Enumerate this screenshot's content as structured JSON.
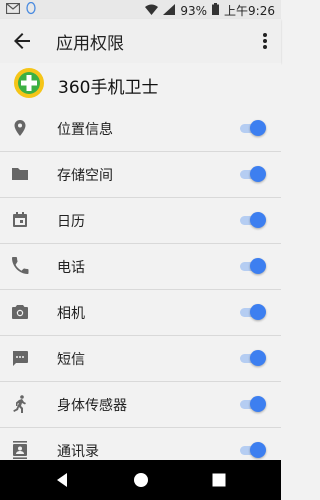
{
  "status": {
    "battery": "93%",
    "time": "上午9:26"
  },
  "appbar": {
    "title": "应用权限"
  },
  "app": {
    "name": "360手机卫士"
  },
  "permissions": [
    {
      "label": "位置信息",
      "icon": "location-icon",
      "enabled": true
    },
    {
      "label": "存储空间",
      "icon": "folder-icon",
      "enabled": true
    },
    {
      "label": "日历",
      "icon": "calendar-icon",
      "enabled": true
    },
    {
      "label": "电话",
      "icon": "phone-icon",
      "enabled": true
    },
    {
      "label": "相机",
      "icon": "camera-icon",
      "enabled": true
    },
    {
      "label": "短信",
      "icon": "sms-icon",
      "enabled": true
    },
    {
      "label": "身体传感器",
      "icon": "body-sensor-icon",
      "enabled": true
    },
    {
      "label": "通讯录",
      "icon": "contacts-icon",
      "enabled": true
    }
  ],
  "colors": {
    "accent": "#3d7ff0",
    "track": "#b5cdf2"
  }
}
